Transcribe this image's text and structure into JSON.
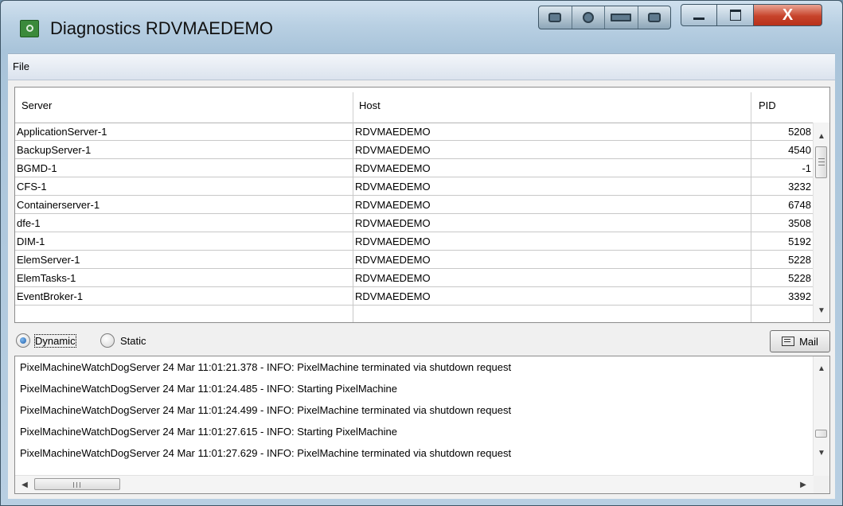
{
  "window": {
    "title": "Diagnostics RDVMAEDEMO",
    "close_glyph": "X"
  },
  "menu": {
    "items": [
      "File"
    ]
  },
  "table": {
    "columns": [
      "Server",
      "Host",
      "PID"
    ],
    "rows": [
      {
        "server": "ApplicationServer-1",
        "host": "RDVMAEDEMO",
        "pid": "5208"
      },
      {
        "server": "BackupServer-1",
        "host": "RDVMAEDEMO",
        "pid": "4540"
      },
      {
        "server": "BGMD-1",
        "host": "RDVMAEDEMO",
        "pid": "-1"
      },
      {
        "server": "CFS-1",
        "host": "RDVMAEDEMO",
        "pid": "3232"
      },
      {
        "server": "Containerserver-1",
        "host": "RDVMAEDEMO",
        "pid": "6748"
      },
      {
        "server": "dfe-1",
        "host": "RDVMAEDEMO",
        "pid": "3508"
      },
      {
        "server": "DIM-1",
        "host": "RDVMAEDEMO",
        "pid": "5192"
      },
      {
        "server": "ElemServer-1",
        "host": "RDVMAEDEMO",
        "pid": "5228"
      },
      {
        "server": "ElemTasks-1",
        "host": "RDVMAEDEMO",
        "pid": "5228"
      },
      {
        "server": "EventBroker-1",
        "host": "RDVMAEDEMO",
        "pid": "3392"
      }
    ]
  },
  "mode": {
    "options": [
      "Dynamic",
      "Static"
    ],
    "selected": "Dynamic"
  },
  "mail_button": {
    "label": "Mail"
  },
  "log": {
    "lines": [
      "PixelMachineWatchDogServer 24 Mar 11:01:21.378 - INFO: PixelMachine terminated via shutdown request",
      "PixelMachineWatchDogServer 24 Mar 11:01:24.485 - INFO: Starting PixelMachine",
      "PixelMachineWatchDogServer 24 Mar 11:01:24.499 - INFO: PixelMachine terminated via shutdown request",
      "PixelMachineWatchDogServer 24 Mar 11:01:27.615 - INFO: Starting PixelMachine",
      "PixelMachineWatchDogServer 24 Mar 11:01:27.629 - INFO: PixelMachine terminated via shutdown request"
    ]
  },
  "icons": {
    "app": "diagnostics-app-icon",
    "minimize": "minimize-icon",
    "maximize": "maximize-icon",
    "close": "close-icon",
    "mail": "mail-icon",
    "scroll_up": "arrow-up-icon",
    "scroll_down": "arrow-down-icon",
    "scroll_left": "arrow-left-icon",
    "scroll_right": "arrow-right-icon"
  },
  "colors": {
    "title_bar": "#b9d0e3",
    "close_button": "#c7432b",
    "radio_selected": "#1f5fa8"
  }
}
